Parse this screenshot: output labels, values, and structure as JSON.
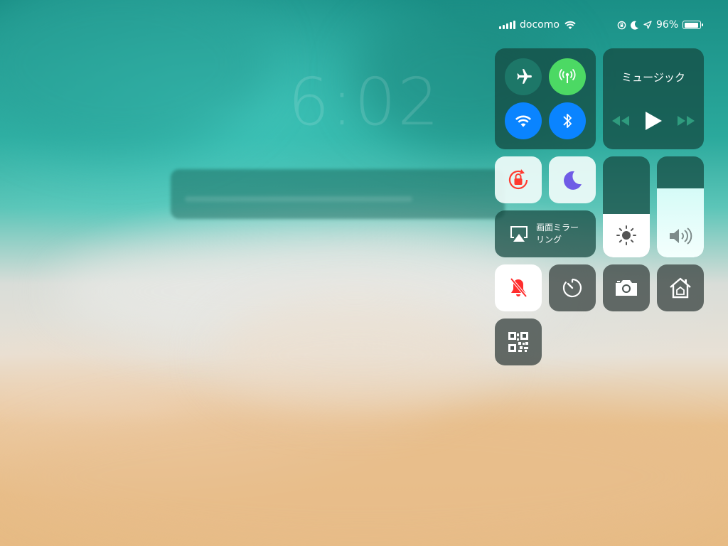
{
  "status_bar": {
    "carrier": "docomo",
    "battery_percent": "96%",
    "battery_level": 0.96
  },
  "lockscreen": {
    "time": "6:02"
  },
  "control_center": {
    "music": {
      "title": "ミュージック"
    },
    "screen_mirroring": {
      "line1": "画面ミラー",
      "line2": "リング"
    },
    "brightness_level": 0.43,
    "volume_level": 0.68,
    "colors": {
      "tile_bg": "#14463e",
      "airplane_bg": "#1e7869",
      "cellular_bg": "#4cd964",
      "wifi_bg": "#0a84ff",
      "bluetooth_bg": "#0a84ff",
      "rotation_icon": "#ff3b30",
      "moon_icon": "#6f5ce6",
      "silent_icon": "#ff2d2d"
    },
    "icons": {
      "airplane": "airplane-icon",
      "cellular": "cellular-data-icon",
      "wifi": "wifi-icon",
      "bluetooth": "bluetooth-icon",
      "rotation": "rotation-lock-icon",
      "dnd": "moon-icon",
      "mirroring": "airplay-icon",
      "brightness": "sun-icon",
      "volume": "speaker-icon",
      "silent": "bell-slash-icon",
      "timer": "timer-icon",
      "camera": "camera-icon",
      "home": "home-icon",
      "qr": "qr-code-icon"
    }
  }
}
